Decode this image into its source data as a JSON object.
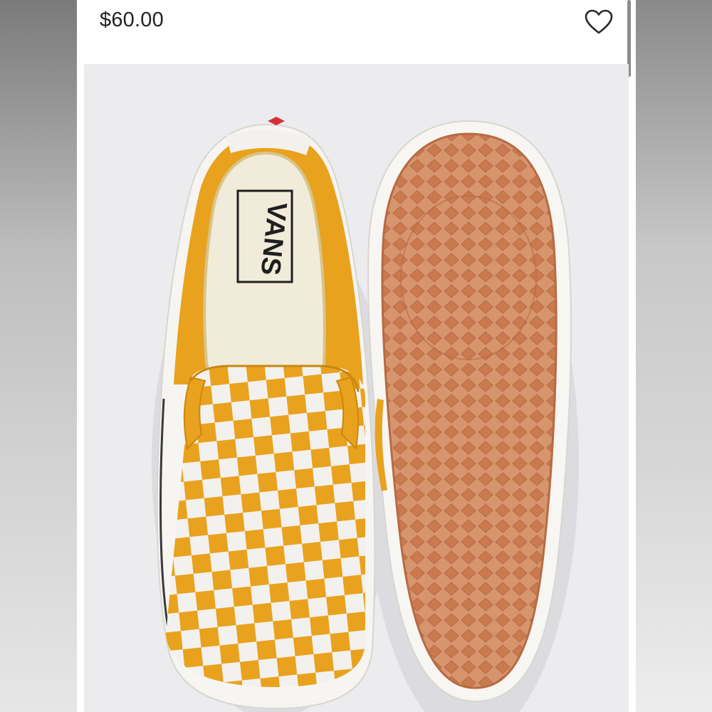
{
  "listing": {
    "price": "$60.00",
    "like_icon": "heart-outline-icon"
  },
  "product_image": {
    "brand_mark_text": "VANS",
    "colors": {
      "upper": "#e9a21e",
      "check_light": "#f3f1ee",
      "sole": "#c97a4e",
      "background": "#ececef"
    }
  }
}
